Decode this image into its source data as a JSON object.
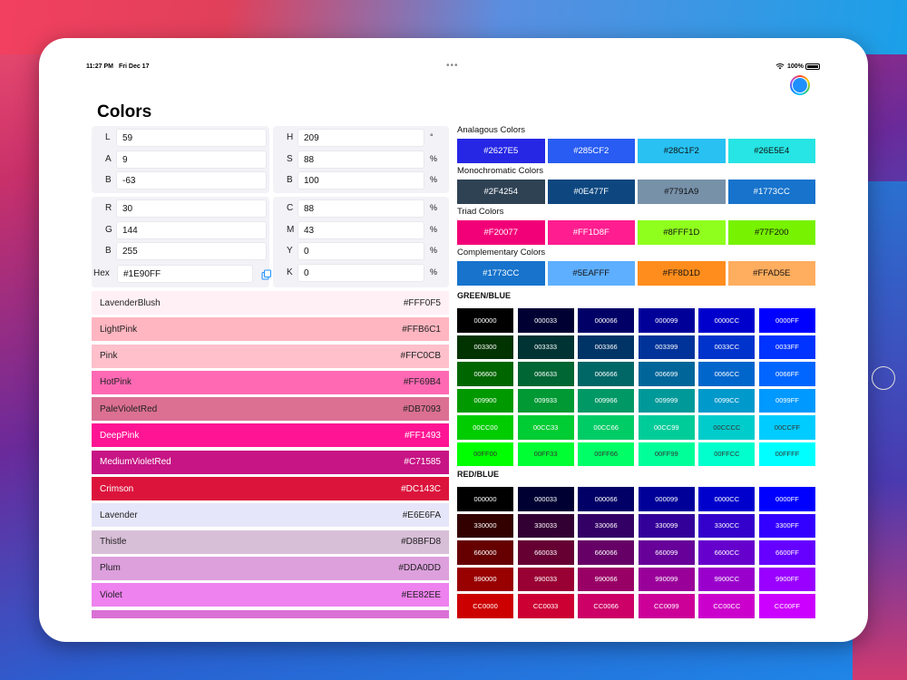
{
  "status": {
    "time": "11:27 PM",
    "date": "Fri Dec 17",
    "dots": "•••",
    "battery": "100%"
  },
  "app": {
    "title": "Colors",
    "current_color": "#1E90FF"
  },
  "lab": [
    {
      "label": "L",
      "value": "59"
    },
    {
      "label": "A",
      "value": "9"
    },
    {
      "label": "B",
      "value": "-63"
    }
  ],
  "hsb": [
    {
      "label": "H",
      "value": "209",
      "unit": "°"
    },
    {
      "label": "S",
      "value": "88",
      "unit": "%"
    },
    {
      "label": "B",
      "value": "100",
      "unit": "%"
    }
  ],
  "rgb": [
    {
      "label": "R",
      "value": "30"
    },
    {
      "label": "G",
      "value": "144"
    },
    {
      "label": "B",
      "value": "255"
    }
  ],
  "cmyk": [
    {
      "label": "C",
      "value": "88",
      "unit": "%"
    },
    {
      "label": "M",
      "value": "43",
      "unit": "%"
    },
    {
      "label": "Y",
      "value": "0",
      "unit": "%"
    },
    {
      "label": "K",
      "value": "0",
      "unit": "%"
    }
  ],
  "hex": {
    "label": "Hex",
    "value": "#1E90FF"
  },
  "named_colors": [
    {
      "name": "LavenderBlush",
      "hex": "#FFF0F5",
      "text": "#222222"
    },
    {
      "name": "LightPink",
      "hex": "#FFB6C1",
      "text": "#222222"
    },
    {
      "name": "Pink",
      "hex": "#FFC0CB",
      "text": "#222222"
    },
    {
      "name": "HotPink",
      "hex": "#FF69B4",
      "text": "#222222"
    },
    {
      "name": "PaleVioletRed",
      "hex": "#DB7093",
      "text": "#222222"
    },
    {
      "name": "DeepPink",
      "hex": "#FF1493",
      "text": "#ffffff"
    },
    {
      "name": "MediumVioletRed",
      "hex": "#C71585",
      "text": "#ffffff"
    },
    {
      "name": "Crimson",
      "hex": "#DC143C",
      "text": "#ffffff"
    },
    {
      "name": "Lavender",
      "hex": "#E6E6FA",
      "text": "#222222"
    },
    {
      "name": "Thistle",
      "hex": "#D8BFD8",
      "text": "#222222"
    },
    {
      "name": "Plum",
      "hex": "#DDA0DD",
      "text": "#222222"
    },
    {
      "name": "Violet",
      "hex": "#EE82EE",
      "text": "#222222"
    }
  ],
  "schemes": [
    {
      "label": "Analagous Colors",
      "swatches": [
        {
          "hex": "#2627E5",
          "text": "#ffffff"
        },
        {
          "hex": "#285CF2",
          "text": "#ffffff"
        },
        {
          "hex": "#28C1F2",
          "text": "#111111"
        },
        {
          "hex": "#26E5E4",
          "text": "#111111"
        }
      ]
    },
    {
      "label": "Monochromatic Colors",
      "swatches": [
        {
          "hex": "#2F4254",
          "text": "#ffffff"
        },
        {
          "hex": "#0E477F",
          "text": "#ffffff"
        },
        {
          "hex": "#7791A9",
          "text": "#111111"
        },
        {
          "hex": "#1773CC",
          "text": "#ffffff"
        }
      ]
    },
    {
      "label": "Triad Colors",
      "swatches": [
        {
          "hex": "#F20077",
          "text": "#ffffff"
        },
        {
          "hex": "#FF1D8F",
          "text": "#ffffff"
        },
        {
          "hex": "#8FFF1D",
          "text": "#111111"
        },
        {
          "hex": "#77F200",
          "text": "#111111"
        }
      ]
    },
    {
      "label": "Complementary Colors",
      "swatches": [
        {
          "hex": "#1773CC",
          "text": "#ffffff"
        },
        {
          "hex": "#5EAFFF",
          "text": "#111111"
        },
        {
          "hex": "#FF8D1D",
          "text": "#111111"
        },
        {
          "hex": "#FFAD5E",
          "text": "#111111"
        }
      ]
    }
  ],
  "green_blue": {
    "title": "GREEN/BLUE",
    "cells": [
      "000000",
      "000033",
      "000066",
      "000099",
      "0000CC",
      "0000FF",
      "003300",
      "003333",
      "003366",
      "003399",
      "0033CC",
      "0033FF",
      "006600",
      "006633",
      "006666",
      "006699",
      "0066CC",
      "0066FF",
      "009900",
      "009933",
      "009966",
      "009999",
      "0099CC",
      "0099FF",
      "00CC00",
      "00CC33",
      "00CC66",
      "00CC99",
      "00CCCC",
      "00CCFF",
      "00FF00",
      "00FF33",
      "00FF66",
      "00FF99",
      "00FFCC",
      "00FFFF"
    ]
  },
  "red_blue": {
    "title": "RED/BLUE",
    "cells": [
      "000000",
      "000033",
      "000066",
      "000099",
      "0000CC",
      "0000FF",
      "330000",
      "330033",
      "330066",
      "330099",
      "3300CC",
      "3300FF",
      "660000",
      "660033",
      "660066",
      "660099",
      "6600CC",
      "6600FF",
      "990000",
      "990033",
      "990066",
      "990099",
      "9900CC",
      "9900FF",
      "CC0000",
      "CC0033",
      "CC0066",
      "CC0099",
      "CC00CC",
      "CC00FF"
    ]
  }
}
